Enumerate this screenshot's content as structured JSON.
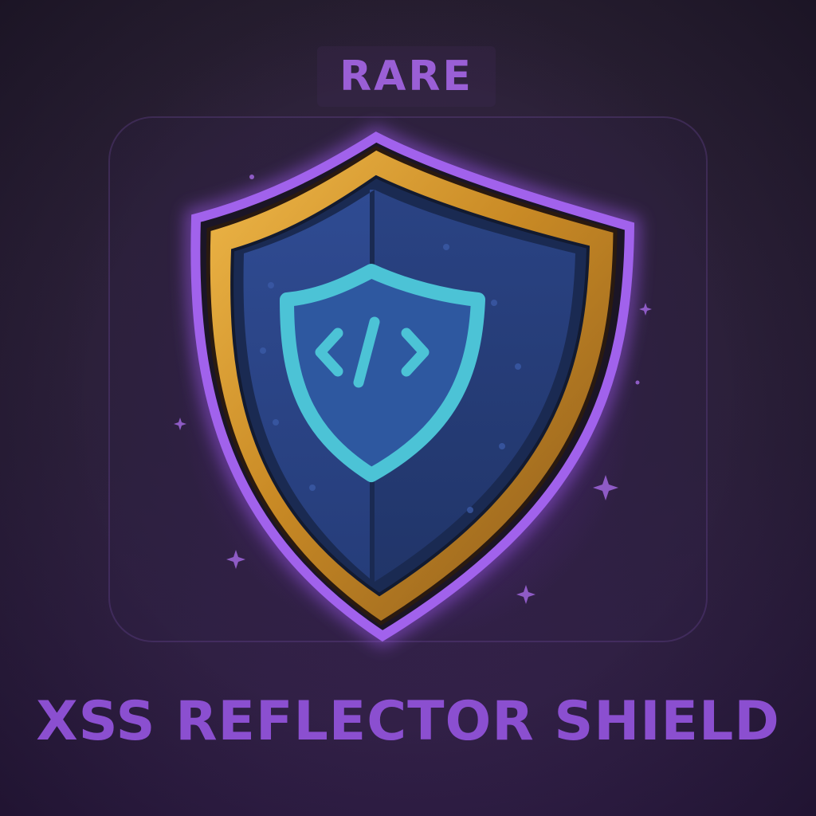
{
  "item": {
    "rarity": "RARE",
    "name": "XSS REFLECTOR SHIELD"
  },
  "icons": {
    "shield": "shield-icon",
    "emblem": "code-shield-icon",
    "code_symbol": "code-brackets-icon",
    "sparkle": "sparkle-icon"
  },
  "colors": {
    "rarity_text": "#9a5fd6",
    "name_text": "#8b4fd0",
    "outer_glow": "#9b59e8",
    "rim_gold": "#d49a2c",
    "shield_face": "#2f4a8e",
    "emblem": "#4cc3d6",
    "background": "#2a2133"
  }
}
